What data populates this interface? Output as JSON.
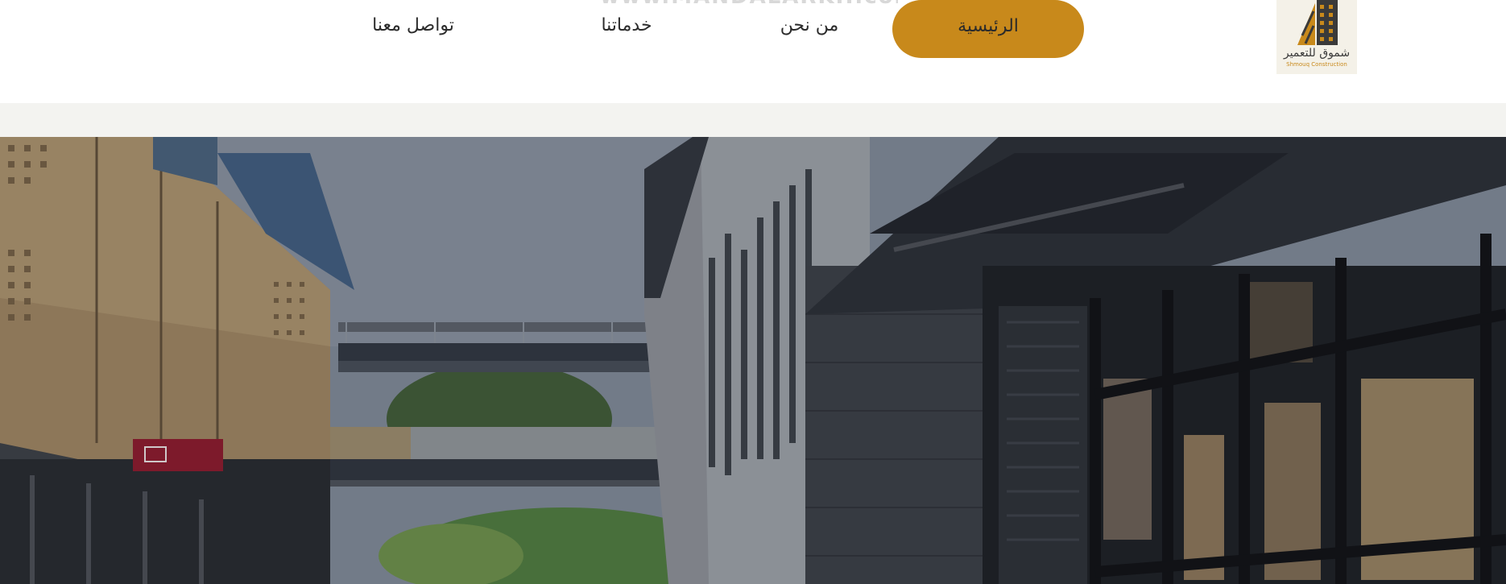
{
  "watermark": {
    "text": "www.MANDALARKH.com"
  },
  "nav": {
    "items": [
      {
        "label": "الرئيسية",
        "active": true
      },
      {
        "label": "من نحن",
        "active": false
      },
      {
        "label": "خدماتنا",
        "active": false
      },
      {
        "label": "تواصل معنا",
        "active": false
      }
    ]
  },
  "logo": {
    "name": "شموق للتعمير",
    "subtitle": "Shmouq Construction"
  },
  "colors": {
    "accent": "#c8891b",
    "nav_text": "#2b2b2b",
    "band": "#f3f3f0"
  },
  "hero": {
    "image": "street-with-modern-buildings-and-skybridges"
  }
}
